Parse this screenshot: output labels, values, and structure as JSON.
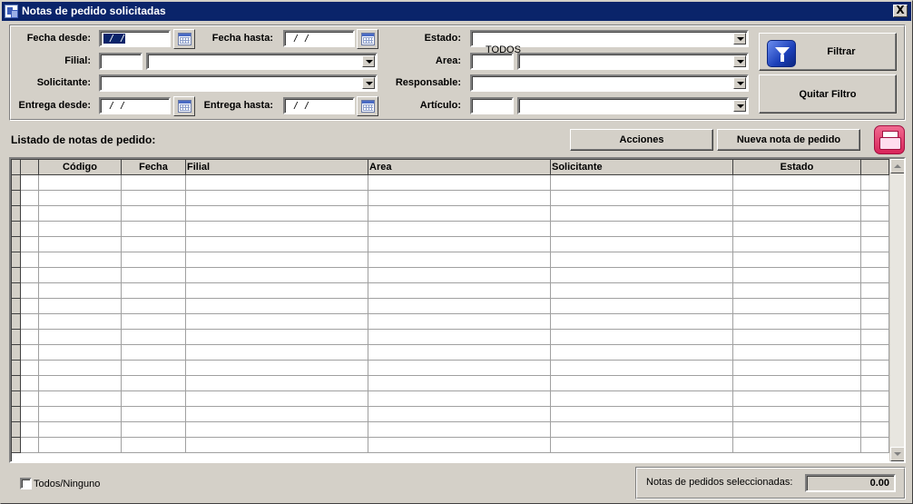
{
  "window": {
    "title": "Notas de pedido solicitadas",
    "close": "X"
  },
  "filters": {
    "fecha_desde": {
      "label": "Fecha desde:",
      "value": " / /"
    },
    "fecha_hasta": {
      "label": "Fecha hasta:",
      "value": " / /"
    },
    "filial": {
      "label": "Filial:",
      "code": "",
      "name": ""
    },
    "solicitante": {
      "label": "Solicitante:",
      "value": ""
    },
    "entrega_desde": {
      "label": "Entrega desde:",
      "value": " / /"
    },
    "entrega_hasta": {
      "label": "Entrega hasta:",
      "value": " / /"
    },
    "estado": {
      "label": "Estado:",
      "value": "TODOS"
    },
    "area": {
      "label": "Area:",
      "code": "",
      "name": ""
    },
    "responsable": {
      "label": "Responsable:",
      "value": ""
    },
    "articulo": {
      "label": "Artículo:",
      "code": "",
      "name": ""
    }
  },
  "buttons": {
    "filtrar": "Filtrar",
    "quitar_filtro": "Quitar Filtro",
    "acciones": "Acciones",
    "nueva_nota": "Nueva nota de pedido"
  },
  "list": {
    "title": "Listado de notas de pedido:",
    "columns": [
      "",
      "",
      "Código",
      "Fecha",
      "Filial",
      "Area",
      "Solicitante",
      "Estado",
      ""
    ],
    "rows": []
  },
  "footer": {
    "check_label": "Todos/Ninguno",
    "summary_label": "Notas de pedidos seleccionadas:",
    "summary_value": "0.00"
  },
  "icons": {
    "filter": "funnel-icon",
    "print": "printer-icon",
    "calendar": "calendar-icon"
  }
}
